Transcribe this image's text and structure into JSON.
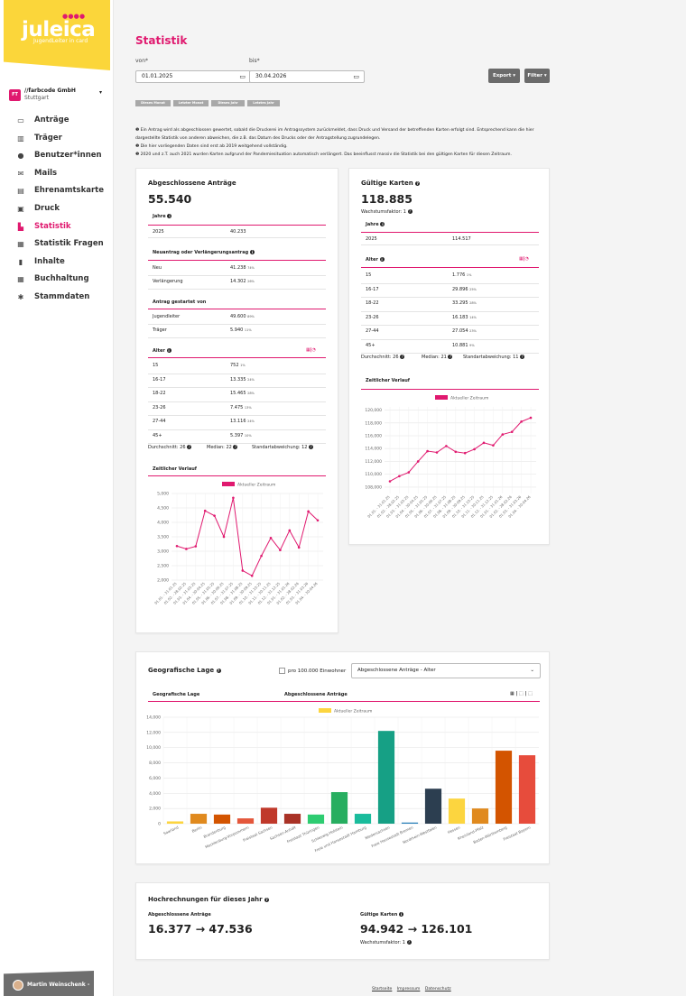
{
  "logo": {
    "text": "juleica",
    "subtitle": "JugendLeiter in card"
  },
  "org": {
    "abbr": "FT",
    "name": "//farbcode GmbH",
    "city": "Stuttgart"
  },
  "nav": [
    {
      "label": "Anträge",
      "icon": "card-icon"
    },
    {
      "label": "Träger",
      "icon": "building-icon"
    },
    {
      "label": "Benutzer*innen",
      "icon": "user-icon"
    },
    {
      "label": "Mails",
      "icon": "mail-icon"
    },
    {
      "label": "Ehrenamtskarte",
      "icon": "id-card-icon"
    },
    {
      "label": "Druck",
      "icon": "printer-icon"
    },
    {
      "label": "Statistik",
      "icon": "chart-icon",
      "active": true
    },
    {
      "label": "Statistik Fragen",
      "icon": "clipboard-icon"
    },
    {
      "label": "Inhalte",
      "icon": "file-icon"
    },
    {
      "label": "Buchhaltung",
      "icon": "calculator-icon"
    },
    {
      "label": "Stammdaten",
      "icon": "gear-icon"
    }
  ],
  "user": {
    "name": "Martin Weinschenk -"
  },
  "page": {
    "title": "Statistik"
  },
  "filters": {
    "from_label": "von*",
    "from_value": "01.01.2025",
    "to_label": "bis*",
    "to_value": "30.04.2026",
    "export": "Export ▾",
    "filter": "Filter ▾"
  },
  "quick": [
    "Dieses Monat",
    "Letzter Monat",
    "Dieses Jahr",
    "Letztes Jahr"
  ],
  "info": [
    "❶ Ein Antrag wird als abgeschlossen gewertet, sobald die Druckerei im Antragssystem zurückmeldet, dass Druck und Versand der betreffenden Karten erfolgt sind. Entsprechend kann die hier",
    "dargestellte Statistik von anderen abweichen, die z.B. das Datum des Drucks oder der Antragstellung zugrundelegen.",
    "❶ Die hier vorliegenden Daten sind erst ab 2019 weitgehend vollständig.",
    "❶ 2020 und z.T. auch 2021 wurden Karten aufgrund der Pandemiesituation automatisch verlängert. Das beeinflusst massiv die Statistik bei den gültigen Karten für diesen Zeitraum."
  ],
  "closed": {
    "title": "Abgeschlossene Anträge",
    "total": "55.540",
    "years_header": "Jahre",
    "years": [
      {
        "label": "2025",
        "value": "40.233"
      }
    ],
    "type_header": "Neuantrag oder Verlängerungsantrag",
    "types": [
      {
        "label": "Neu",
        "value": "41.238",
        "pct": "74%"
      },
      {
        "label": "Verlängerung",
        "value": "14.302",
        "pct": "26%"
      }
    ],
    "started_header": "Antrag gestartet von",
    "started": [
      {
        "label": "Jugendleiter",
        "value": "49.600",
        "pct": "89%"
      },
      {
        "label": "Träger",
        "value": "5.940",
        "pct": "11%"
      }
    ],
    "age_header": "Alter",
    "ages": [
      {
        "label": "15",
        "value": "752",
        "pct": "1%"
      },
      {
        "label": "16-17",
        "value": "13.335",
        "pct": "24%"
      },
      {
        "label": "18-22",
        "value": "15.465",
        "pct": "28%"
      },
      {
        "label": "23-26",
        "value": "7.475",
        "pct": "13%"
      },
      {
        "label": "27-44",
        "value": "13.116",
        "pct": "24%"
      },
      {
        "label": "45+",
        "value": "5.397",
        "pct": "10%"
      }
    ],
    "stats": {
      "avg": "Durchschnitt: 26",
      "median": "Median: 22",
      "std": "Standartabweichung: 12"
    },
    "trend_header": "Zeitlicher Verlauf"
  },
  "valid": {
    "title": "Gültige Karten",
    "total": "118.885",
    "growth": "Wachstumsfaktor: 1",
    "years_header": "Jahre",
    "years": [
      {
        "label": "2025",
        "value": "114.517"
      }
    ],
    "age_header": "Alter",
    "ages": [
      {
        "label": "15",
        "value": "1.776",
        "pct": "1%"
      },
      {
        "label": "16-17",
        "value": "29.896",
        "pct": "25%"
      },
      {
        "label": "18-22",
        "value": "33.295",
        "pct": "28%"
      },
      {
        "label": "23-26",
        "value": "16.183",
        "pct": "14%"
      },
      {
        "label": "27-44",
        "value": "27.054",
        "pct": "23%"
      },
      {
        "label": "45+",
        "value": "10.881",
        "pct": "9%"
      }
    ],
    "stats": {
      "avg": "Durchschnitt: 26",
      "median": "Median: 21",
      "std": "Standartabweichung: 11"
    },
    "trend_header": "Zeitlicher Verlauf"
  },
  "geo": {
    "title": "Geografische Lage",
    "checkbox": "pro 100.000 Einwohner",
    "select": "Abgeschlossene Anträge - Alter",
    "col1": "Geografische Lage",
    "col2": "Abgeschlossene Anträge",
    "toggle_icons": "▦ | ⬚ | ⬚"
  },
  "projection": {
    "title": "Hochrechnungen für dieses Jahr",
    "closed_label": "Abgeschlossene Anträge",
    "closed_value": "16.377 → 47.536",
    "valid_label": "Gültige Karten",
    "valid_value": "94.942 → 126.101",
    "growth": "Wachstumsfaktor: 1"
  },
  "footer": [
    "Startseite",
    "Impressum",
    "Datenschutz"
  ],
  "chart_data": [
    {
      "type": "line",
      "title": "",
      "legend": "Aktueller Zeitraum",
      "color": "#e0196f",
      "x": [
        "01.01. - 31.01.25",
        "01.02. - 28.02.25",
        "01.03. - 31.03.25",
        "01.04. - 30.04.25",
        "01.05. - 31.05.25",
        "01.06. - 30.06.25",
        "01.07. - 31.07.25",
        "01.08. - 31.08.25",
        "01.09. - 30.09.25",
        "01.10. - 31.10.25",
        "01.11. - 30.11.25",
        "01.12. - 31.12.25",
        "01.01. - 31.01.26",
        "01.02. - 28.02.26",
        "01.03. - 31.03.26",
        "01.04. - 30.04.26"
      ],
      "y": [
        3180,
        3080,
        3170,
        4400,
        4230,
        3500,
        4850,
        2330,
        2150,
        2840,
        3460,
        3040,
        3720,
        3130,
        4380,
        4070
      ],
      "yticks": [
        "5,000",
        "4,500",
        "4,000",
        "3,500",
        "3,000",
        "2,500",
        "2,000"
      ],
      "ylim": [
        2000,
        5000
      ]
    },
    {
      "type": "line",
      "title": "",
      "legend": "Aktueller Zeitraum",
      "color": "#e0196f",
      "x": [
        "01.01. - 31.01.25",
        "01.02. - 28.02.25",
        "01.03. - 31.03.25",
        "01.04. - 30.04.25",
        "01.05. - 31.05.25",
        "01.06. - 30.06.25",
        "01.07. - 31.07.25",
        "01.08. - 31.08.25",
        "01.09. - 30.09.25",
        "01.10. - 31.10.25",
        "01.11. - 30.11.25",
        "01.12. - 31.12.25",
        "01.01. - 31.01.26",
        "01.02. - 28.02.26",
        "01.03. - 31.03.26",
        "01.04. - 30.04.26"
      ],
      "y": [
        108900,
        109700,
        110300,
        112000,
        113600,
        113400,
        114400,
        113500,
        113300,
        113900,
        114900,
        114500,
        116200,
        116600,
        118200,
        118800
      ],
      "yticks": [
        "120,000",
        "118,000",
        "116,000",
        "114,000",
        "112,000",
        "110,000",
        "108,000"
      ],
      "ylim": [
        107000,
        120500
      ]
    },
    {
      "type": "bar",
      "title": "",
      "legend": "Aktueller Zeitraum",
      "legend_color": "#fcd53f",
      "categories": [
        "Saarland",
        "Berlin",
        "Brandenburg",
        "Mecklenburg-Vorpommern",
        "Freistaat Sachsen",
        "Sachsen-Anhalt",
        "Freistaat Thüringen",
        "Schleswig-Holstein",
        "Freie und Hansestadt Hamburg",
        "Niedersachsen",
        "Freie Hansestadt Bremen",
        "Nordrhein-Westfalen",
        "Hessen",
        "Rheinland-Pfalz",
        "Baden-Württemberg",
        "Freistaat Bayern"
      ],
      "values": [
        300,
        1300,
        1200,
        700,
        2100,
        1300,
        1200,
        4150,
        1300,
        12200,
        150,
        4600,
        3300,
        2000,
        9600,
        9000
      ],
      "colors": [
        "#fcd53f",
        "#e08a1e",
        "#d35400",
        "#e4573b",
        "#c0392b",
        "#a93226",
        "#2ecc71",
        "#27ae60",
        "#1abc9c",
        "#16a085",
        "#2980b9",
        "#2c3e50",
        "#fcd53f",
        "#e08a1e",
        "#d35400",
        "#e74c3c"
      ],
      "yticks": [
        "14,000",
        "12,000",
        "10,000",
        "8,000",
        "6,000",
        "4,000",
        "2,000",
        "0"
      ],
      "ylim": [
        0,
        14000
      ]
    }
  ]
}
